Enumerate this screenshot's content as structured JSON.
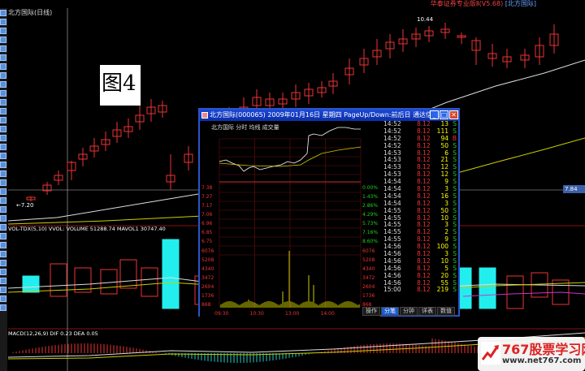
{
  "title_bar": {
    "app_title": "华泰证券专业版Ⅱ(V5.68)",
    "stock_bracket": "[北方国际]"
  },
  "chart": {
    "stock_label": "北方国际(日线)",
    "high_label": "10.44",
    "low_label": "←7.20",
    "right_price_tag": "7.84",
    "vol_label": "VOL-TDX(5,10) VVOL: VOLUME 51288.74  MAVOL1 30747.40",
    "macd_label": "MACD(12,26,9) DIF 0.23  DEA 0.05",
    "fig_tag": "图4"
  },
  "dialog": {
    "title": "北方国际(000065) 2009年01月16日 星期四 PageUp/Down:前后日 通达信(R)",
    "subheader": "北方国际   分时 均线 成交量",
    "price_axis_left": [
      "7.38",
      "7.27",
      "7.17",
      "7.06",
      "6.96",
      "6.85",
      "6.75"
    ],
    "pct_axis_right": [
      "0.00%",
      "1.43%",
      "2.86%",
      "4.29%",
      "5.73%",
      "7.16%",
      "8.60%"
    ],
    "vol_axis_left": [
      "6076",
      "5208",
      "4340",
      "3472",
      "2604",
      "1736",
      "868"
    ],
    "vol_axis_right": [
      "6076",
      "5208",
      "4340",
      "3472",
      "2604",
      "1736",
      "868"
    ],
    "time_axis": [
      "09:30",
      "10:30",
      "13:00",
      "14:00"
    ],
    "tabs": [
      "操作",
      "分笔",
      "分钟",
      "详表",
      "数值"
    ],
    "ticks": [
      {
        "time": "14:52",
        "price": "8.12",
        "vol": "13",
        "side": "S"
      },
      {
        "time": "14:52",
        "price": "8.12",
        "vol": "111",
        "side": "S"
      },
      {
        "time": "14:52",
        "price": "8.12",
        "vol": "94",
        "side": "B"
      },
      {
        "time": "14:52",
        "price": "8.12",
        "vol": "50",
        "side": "S"
      },
      {
        "time": "14:53",
        "price": "8.12",
        "vol": "6",
        "side": "S"
      },
      {
        "time": "14:53",
        "price": "8.12",
        "vol": "21",
        "side": "S"
      },
      {
        "time": "14:53",
        "price": "8.12",
        "vol": "12",
        "side": "S"
      },
      {
        "time": "14:53",
        "price": "8.12",
        "vol": "12",
        "side": "S"
      },
      {
        "time": "14:54",
        "price": "8.12",
        "vol": "9",
        "side": "S"
      },
      {
        "time": "14:54",
        "price": "8.12",
        "vol": "3",
        "side": "S"
      },
      {
        "time": "14:54",
        "price": "8.12",
        "vol": "16",
        "side": "S"
      },
      {
        "time": "14:54",
        "price": "8.12",
        "vol": "3",
        "side": "S"
      },
      {
        "time": "14:55",
        "price": "8.12",
        "vol": "50",
        "side": "S"
      },
      {
        "time": "14:55",
        "price": "8.12",
        "vol": "10",
        "side": "S"
      },
      {
        "time": "14:55",
        "price": "8.12",
        "vol": "3",
        "side": "S"
      },
      {
        "time": "14:55",
        "price": "8.12",
        "vol": "2",
        "side": "S"
      },
      {
        "time": "14:55",
        "price": "8.12",
        "vol": "9",
        "side": "S"
      },
      {
        "time": "14:56",
        "price": "8.12",
        "vol": "100",
        "side": "S"
      },
      {
        "time": "14:56",
        "price": "8.12",
        "vol": "3",
        "side": "S"
      },
      {
        "time": "14:56",
        "price": "8.12",
        "vol": "10",
        "side": "S"
      },
      {
        "time": "14:56",
        "price": "8.12",
        "vol": "5",
        "side": "S"
      },
      {
        "time": "14:56",
        "price": "8.12",
        "vol": "20",
        "side": "S"
      },
      {
        "time": "14:56",
        "price": "8.12",
        "vol": "55",
        "side": "S"
      },
      {
        "time": "15:00",
        "price": "8.12",
        "vol": "219",
        "side": "S"
      }
    ]
  },
  "watermark": {
    "brand": "767股票学习网",
    "url": "www.net767.com"
  }
}
